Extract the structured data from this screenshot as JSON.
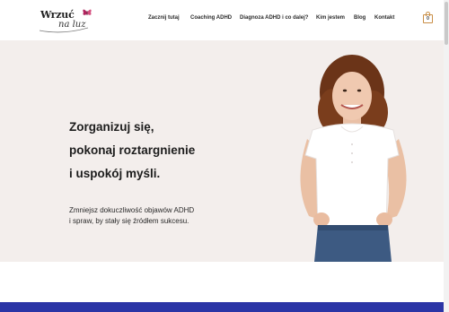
{
  "header": {
    "logo": {
      "main": "Wrzuć",
      "sub": "na luz",
      "mark_icon": "butterfly-icon"
    },
    "nav": [
      {
        "label": "Zacznij tutaj"
      },
      {
        "label": "Coaching ADHD"
      },
      {
        "label": "Diagnoza ADHD i co dalej?"
      },
      {
        "label": "Kim jestem"
      },
      {
        "label": "Blog"
      },
      {
        "label": "Kontakt"
      }
    ],
    "cart": {
      "icon": "shopping-bag-icon",
      "count": "0"
    }
  },
  "hero": {
    "headline": [
      "Zorganizuj się,",
      "pokonaj roztargnienie",
      "i uspokój myśli."
    ],
    "subtext": [
      "Zmniejsz dokuczliwość objawów ADHD",
      "i spraw, by stały się źródłem sukcesu."
    ],
    "photo": "portrait of a smiling woman with curly hair, white t-shirt, jeans, hands on hips"
  },
  "colors": {
    "hero_bg": "#f3eeec",
    "band": "#2b35a6",
    "accent": "#c98f47",
    "logo_mark": "#b0245e"
  }
}
